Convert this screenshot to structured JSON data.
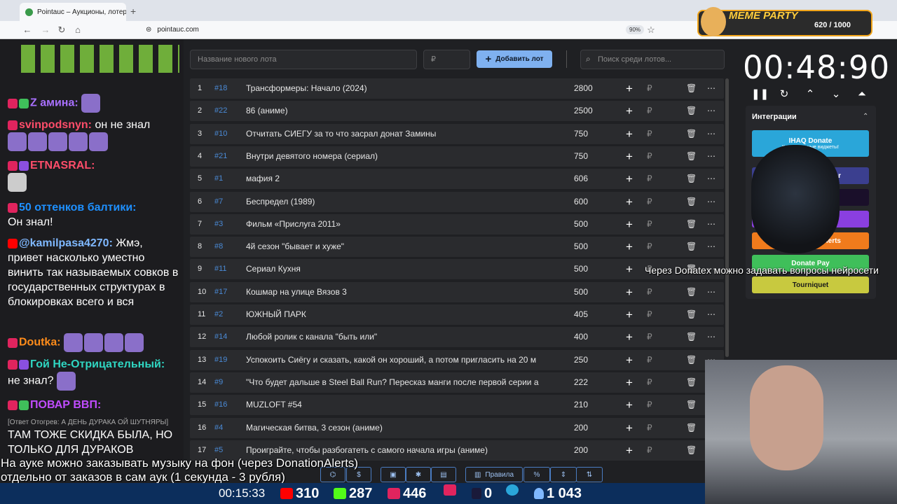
{
  "browser": {
    "tab_title": "Pointauc – Аукционы, лотереи",
    "tab_close": "✕",
    "new_tab": "+",
    "url": "pointauc.com",
    "zoom": "90%"
  },
  "chat": {
    "messages": [
      {
        "user": "Z амина:",
        "text": "",
        "user_color": "#a970ff"
      },
      {
        "user": "svinpodsnyn:",
        "text": "он не знал",
        "user_color": "#ff4d6a"
      },
      {
        "user": "ETNASRAL:",
        "text": "",
        "user_color": "#ff4d6a"
      },
      {
        "user": "50 оттенков балтики:",
        "text": "Он знал!",
        "user_color": "#1e90ff"
      },
      {
        "user": "@kamilpasa4270:",
        "text": "Жмэ, привет насколько уместно винить так называемых совков в государственных структурах в блокировках всего и вся",
        "user_color": "#7fb8ff"
      },
      {
        "user": "Doutka:",
        "text": "",
        "user_color": "#ff8c1a"
      },
      {
        "user": "Гой Не-Отрицательный:",
        "text": "не знал?",
        "user_color": "#2fd6c2"
      },
      {
        "user": "ПОВАР ВВП:",
        "text": "",
        "user_color": "#c04cff"
      },
      {
        "user": "",
        "text": "[Ответ Отогрев: А ДЕНЬ ДУРАКА ОЙ ШУТНЯРЫ]",
        "user_color": "#aaaaaa"
      },
      {
        "user": "",
        "text": "ТАМ ТОЖЕ СКИДКА БЫЛА, НО ТОЛЬКО ДЛЯ ДУРАКОВ",
        "user_color": "#ffffff"
      }
    ]
  },
  "toolbar": {
    "new_lot_placeholder": "Название нового лота",
    "amount_placeholder": "₽",
    "add_label": "Добавить лот",
    "search_placeholder": "Поиск среди лотов..."
  },
  "lots": [
    {
      "n": "1",
      "id": "#18",
      "name": "Трансформеры: Начало (2024)",
      "amount": "2800"
    },
    {
      "n": "2",
      "id": "#22",
      "name": "86 (аниме)",
      "amount": "2500"
    },
    {
      "n": "3",
      "id": "#10",
      "name": "Отчитать СИЕГУ за то что засрал донат Замины",
      "amount": "750"
    },
    {
      "n": "4",
      "id": "#21",
      "name": "Внутри девятого номера (сериал)",
      "amount": "750"
    },
    {
      "n": "5",
      "id": "#1",
      "name": "мафия 2",
      "amount": "606"
    },
    {
      "n": "6",
      "id": "#7",
      "name": "Беспредел (1989)",
      "amount": "600"
    },
    {
      "n": "7",
      "id": "#3",
      "name": "Фильм «Прислуга 2011»",
      "amount": "500"
    },
    {
      "n": "8",
      "id": "#8",
      "name": "4й сезон \"бывает и хуже\"",
      "amount": "500"
    },
    {
      "n": "9",
      "id": "#11",
      "name": "Сериал Кухня",
      "amount": "500"
    },
    {
      "n": "10",
      "id": "#17",
      "name": "Кошмар на улице Вязов 3",
      "amount": "500"
    },
    {
      "n": "11",
      "id": "#2",
      "name": "ЮЖНЫЙ ПАРК",
      "amount": "405"
    },
    {
      "n": "12",
      "id": "#14",
      "name": "Любой ролик с канала \"быть или\"",
      "amount": "400"
    },
    {
      "n": "13",
      "id": "#19",
      "name": "Успокоить Сиёгу и сказать, какой он хороший, а потом пригласить на 20 м",
      "amount": "250"
    },
    {
      "n": "14",
      "id": "#9",
      "name": "\"Что будет дальше в Steel Ball Run? Пересказ манги после первой серии а",
      "amount": "222"
    },
    {
      "n": "15",
      "id": "#16",
      "name": "MUZLOFT #54",
      "amount": "210"
    },
    {
      "n": "16",
      "id": "#4",
      "name": "Магическая битва, 3 сезон (аниме)",
      "amount": "200"
    },
    {
      "n": "17",
      "id": "#5",
      "name": "Проиграйте, чтобы разбогатеть с самого начала игры (аниме)",
      "amount": "200"
    }
  ],
  "row_symbols": {
    "plus": "+",
    "ruble": "₽",
    "trash": "🗑",
    "dots": "⋯"
  },
  "timer": {
    "value": "00:48:90"
  },
  "integrations": {
    "title": "Интеграции",
    "items": [
      "IHAQ Donate",
      "Donate Pay",
      "Tourniquet"
    ],
    "donatealerts_label": "lerts",
    "donatex_label": "er",
    "ihaq_sub": "Ка                  уникальные виджеты!"
  },
  "captions": {
    "right": "Через Donatex можно задавать вопросы нейросети",
    "bottom_1": "На ауке можно заказывать музыку на фон (через DonationAlerts)",
    "bottom_2": "отдельно от заказов в сам аук (1 секунда - 3 рубля)"
  },
  "bottom_toolbar": {
    "rules": "Правила",
    "percent": "%",
    "dollar": "$"
  },
  "stream_stats": {
    "uptime": "00:15:33",
    "youtube": "310",
    "kick": "287",
    "live": "446",
    "rutube": "0",
    "viewers": "1 043"
  },
  "overlay": {
    "title": "MEME PARTY",
    "counter": "620 / 1000"
  },
  "colors": {
    "accent": "#7fb1f0",
    "id": "#4a8ad6",
    "ihaq": "#2aa6d9",
    "donatepay": "#3fbf5a",
    "tourniquet": "#c8c93f",
    "donatealerts": "#f07b1c"
  }
}
